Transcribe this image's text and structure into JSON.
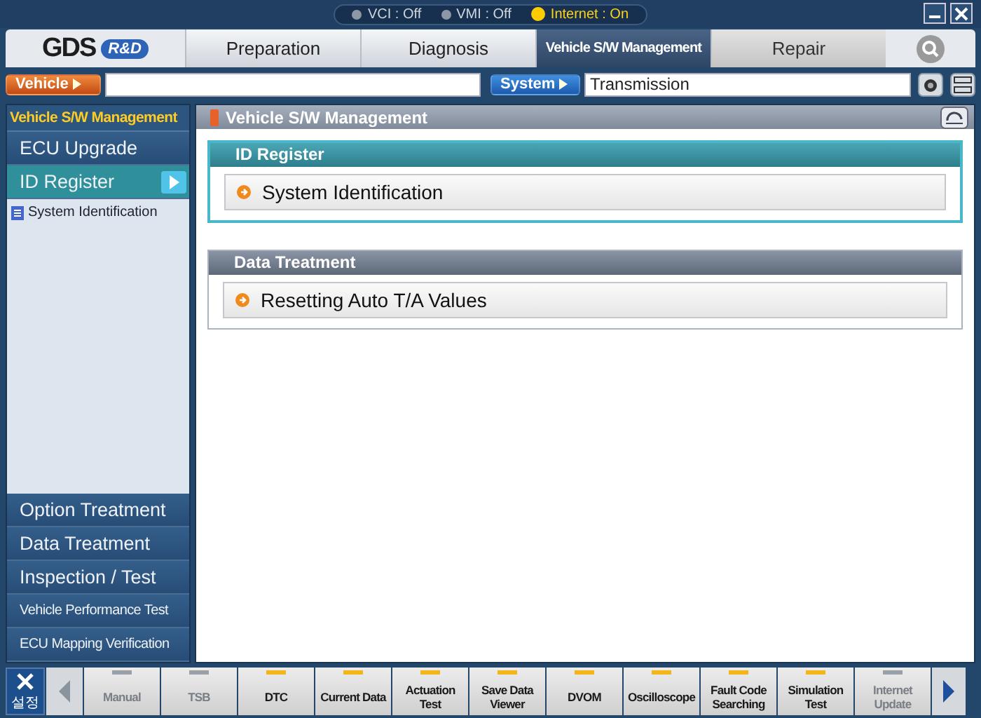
{
  "status": [
    {
      "label": "VCI : Off",
      "on": false
    },
    {
      "label": "VMI : Off",
      "on": false
    },
    {
      "label": "Internet : On",
      "on": true
    }
  ],
  "logo": {
    "mark": "GDS",
    "badge": "R&D"
  },
  "tabs": [
    {
      "label": "Preparation",
      "selected": false
    },
    {
      "label": "Diagnosis",
      "selected": false
    },
    {
      "label": "Vehicle S/W Management",
      "selected": true
    },
    {
      "label": "Repair",
      "selected": false
    }
  ],
  "selectors": {
    "vehicle_button": "Vehicle",
    "system_button": "System",
    "system_value": "Transmission"
  },
  "sidebar": {
    "title": "Vehicle S/W Management",
    "top_items": [
      {
        "label": "ECU Upgrade",
        "selected": false
      },
      {
        "label": "ID Register",
        "selected": true
      }
    ],
    "sub_items": [
      "System Identification"
    ],
    "bottom_items": [
      {
        "label": "Option Treatment",
        "selected": false,
        "kind": "normal"
      },
      {
        "label": "Data Treatment",
        "selected": false,
        "kind": "normal"
      },
      {
        "label": "Inspection / Test",
        "selected": false,
        "kind": "normal"
      },
      {
        "label": "Vehicle Performance Test",
        "selected": false,
        "kind": "small"
      },
      {
        "label": "ECU Mapping Verification",
        "selected": false,
        "kind": "small"
      }
    ]
  },
  "content": {
    "title": "Vehicle S/W Management",
    "sections": [
      {
        "title": "ID Register",
        "selected": true,
        "items": [
          "System Identification"
        ]
      },
      {
        "title": "Data Treatment",
        "selected": false,
        "items": [
          "Resetting Auto T/A Values"
        ]
      }
    ]
  },
  "toolbar": {
    "settings_label": "설정",
    "buttons": [
      {
        "label": "Manual",
        "enabled": false
      },
      {
        "label": "TSB",
        "enabled": false
      },
      {
        "label": "DTC",
        "enabled": true
      },
      {
        "label": "Current Data",
        "enabled": true
      },
      {
        "label": "Actuation Test",
        "enabled": true
      },
      {
        "label": "Save Data Viewer",
        "enabled": true
      },
      {
        "label": "DVOM",
        "enabled": true
      },
      {
        "label": "Oscilloscope",
        "enabled": true
      },
      {
        "label": "Fault Code Searching",
        "enabled": true
      },
      {
        "label": "Simulation Test",
        "enabled": true
      },
      {
        "label": "Internet Update",
        "enabled": false
      }
    ]
  }
}
